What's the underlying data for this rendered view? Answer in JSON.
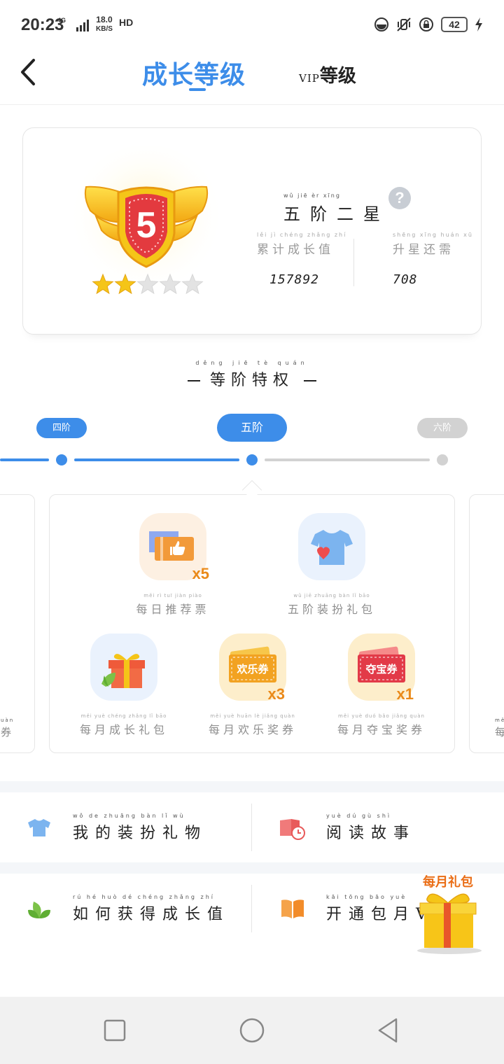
{
  "status_bar": {
    "time": "20:23",
    "network": "4G",
    "speed_value": "18.0",
    "speed_unit": "KB/S",
    "hd": "HD",
    "battery": "42"
  },
  "header": {
    "active_tab": "成长等级",
    "other_tab_prefix": "VIP",
    "other_tab_suffix": "等级"
  },
  "level_card": {
    "badge_number": "5",
    "stars_filled": 2,
    "stars_total": 5,
    "rank_pinyin": "wǔ jiē èr xīng",
    "rank_name": "五阶二星",
    "help": "?",
    "cumulative_pinyin": "lěi jì chéng zhǎng zhí",
    "cumulative_label": "累计成长值",
    "cumulative_value": "157892",
    "needed_pinyin": "shēng xīng huán xū",
    "needed_label": "升星还需",
    "needed_value": "708"
  },
  "privileges": {
    "title_pinyin": "děng jiē tè quán",
    "title": "等阶特权",
    "tiers": [
      {
        "label": "四阶",
        "state": "passed"
      },
      {
        "label": "五阶",
        "state": "current"
      },
      {
        "label": "六阶",
        "state": "locked"
      }
    ],
    "perks": [
      {
        "pinyin": "měi rì tuī jiàn piào",
        "label": "每日推荐票",
        "multiplier": "x5",
        "icon": "recommend-ticket-icon"
      },
      {
        "pinyin": "wǔ jiē zhuāng bàn lǐ bāo",
        "label": "五阶装扮礼包",
        "icon": "tshirt-heart-icon"
      },
      {
        "pinyin": "měi yuè chéng zhǎng lǐ bāo",
        "label": "每月成长礼包",
        "icon": "gift-box-icon"
      },
      {
        "pinyin": "měi yuè huān lè jiǎng quàn",
        "label": "每月欢乐奖券",
        "multiplier": "x3",
        "coupon_text": "欢乐券",
        "icon": "happy-coupon-icon"
      },
      {
        "pinyin": "měi yuè duó bǎo jiǎng quàn",
        "label": "每月夺宝奖券",
        "multiplier": "x1",
        "coupon_text": "夺宝券",
        "icon": "treasure-coupon-icon"
      }
    ],
    "left_card_edge_text": "券",
    "left_card_edge_pinyin": "uàn",
    "right_card_edge_text": "每",
    "right_card_edge_pinyin": "měi"
  },
  "menu": {
    "items": [
      {
        "pinyin": "wǒ de zhuāng bàn lǐ wù",
        "label": "我的装扮礼物",
        "icon": "tshirt-icon"
      },
      {
        "pinyin": "yuè dú gù shì",
        "label": "阅读故事",
        "icon": "reading-story-icon"
      },
      {
        "pinyin": "rú hé huò dé chéng zhǎng zhí",
        "label": "如何获得成长值",
        "icon": "leaf-icon"
      },
      {
        "pinyin": "kāi tōng bāo yuè",
        "label": "开通包月V",
        "icon": "open-book-icon"
      }
    ]
  },
  "floating_gift": {
    "label": "每月礼包",
    "icon": "monthly-gift-icon"
  },
  "colors": {
    "accent": "#3d8de9",
    "inactive": "#d2d2d2",
    "orange": "#ea8a1a",
    "gold": "#f5c518"
  }
}
